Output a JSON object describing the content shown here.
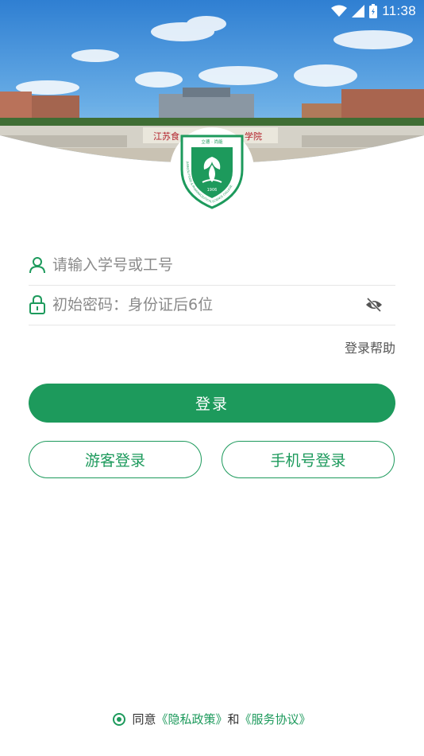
{
  "status_bar": {
    "time": "11:38"
  },
  "hero": {
    "gate_sign_left": "江苏食",
    "gate_sign_right": "学院"
  },
  "logo": {
    "top_text": "立德 · 尚能",
    "ring_text": "JIANGSU FOOD & PHARMACEUTICAL SCIENCE COLLEGE",
    "year": "1906"
  },
  "form": {
    "username_placeholder": "请输入学号或工号",
    "password_placeholder": "初始密码：身份证后6位",
    "help_link": "登录帮助",
    "login_button": "登录",
    "guest_button": "游客登录",
    "phone_button": "手机号登录"
  },
  "agreement": {
    "prefix": "同意",
    "privacy": "《隐私政策》",
    "and": "和",
    "service": "《服务协议》"
  },
  "colors": {
    "accent": "#1d9a5c",
    "sky": "#3e8fd8",
    "placeholder": "#8a8a8a"
  },
  "icons": {
    "user": "user-icon",
    "lock": "lock-icon",
    "eye": "eye-off-icon",
    "wifi": "wifi-icon",
    "signal": "signal-icon",
    "battery": "battery-icon"
  }
}
